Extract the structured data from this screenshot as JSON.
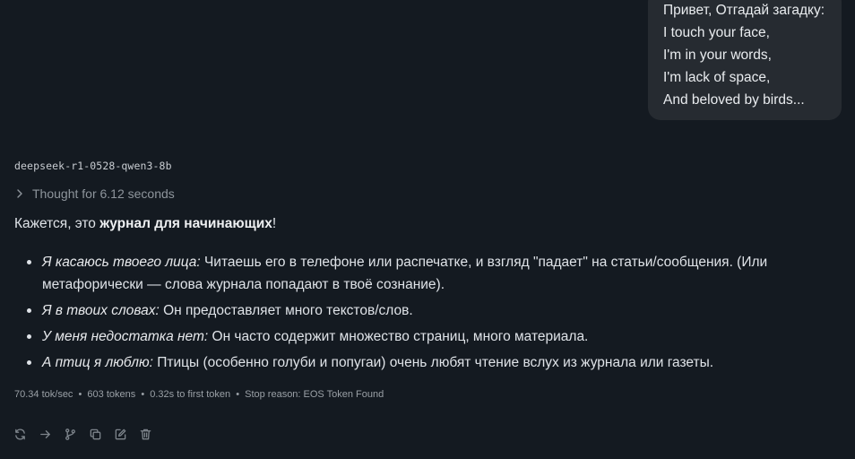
{
  "user_message": {
    "lines": [
      "Привет, Отгадай загадку:",
      "I touch your face,",
      "I'm in your words,",
      "I'm lack of space,",
      "And beloved by birds..."
    ]
  },
  "assistant": {
    "model_name": "deepseek-r1-0528-qwen3-8b",
    "thought_label": "Thought for 6.12 seconds",
    "intro_prefix": "Кажется, это ",
    "intro_bold": "журнал для начинающих",
    "intro_suffix": "!",
    "items": [
      {
        "italic": "Я касаюсь твоего лица:",
        "text": " Читаешь его в телефоне или распечатке, и взгляд \"падает\" на статьи/сообщения. (Или метафорически — слова журнала попадают в твоё сознание)."
      },
      {
        "italic": "Я в твоих словах:",
        "text": " Он предоставляет много текстов/слов."
      },
      {
        "italic": "У меня недостатка нет:",
        "text": " Он часто содержит множество страниц, много материала."
      },
      {
        "italic": "А птиц я люблю:",
        "text": " Птицы (особенно голуби и попугаи) очень любят чтение вслух из журнала или газеты."
      }
    ],
    "stats": {
      "speed": "70.34 tok/sec",
      "tokens": "603 tokens",
      "first_token": "0.32s to first token",
      "stop_reason": "Stop reason: EOS Token Found",
      "separator": "•"
    },
    "actions": [
      {
        "icon": "regenerate-icon"
      },
      {
        "icon": "continue-arrow-icon"
      },
      {
        "icon": "branch-icon"
      },
      {
        "icon": "copy-icon"
      },
      {
        "icon": "edit-icon"
      },
      {
        "icon": "delete-icon"
      }
    ]
  },
  "colors": {
    "background": "#141a21",
    "bubble": "#262b31",
    "text": "#dfe3e8",
    "muted": "#8e959c"
  }
}
